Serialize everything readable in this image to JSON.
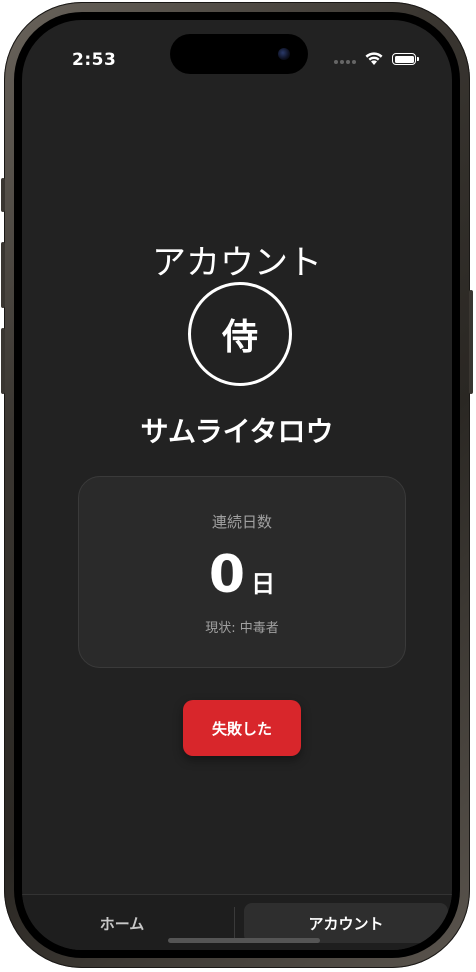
{
  "status_bar": {
    "time": "2:53"
  },
  "page": {
    "title": "アカウント",
    "avatar_text": "侍",
    "username": "サムライタロウ"
  },
  "streak": {
    "label": "連続日数",
    "value": "0",
    "unit": "日",
    "status": "現状: 中毒者"
  },
  "actions": {
    "fail_label": "失敗した"
  },
  "tab_bar": {
    "tabs": [
      {
        "label": "ホーム",
        "active": false
      },
      {
        "label": "アカウント",
        "active": true
      }
    ]
  },
  "colors": {
    "background": "#222222",
    "card": "#2a2a2a",
    "accent_red": "#d8262b",
    "text_primary": "#ffffff",
    "text_secondary": "#a0a0a0"
  },
  "icons": {
    "wifi": "wifi-icon",
    "battery": "battery-icon",
    "signal": "cellular-signal-icon"
  }
}
